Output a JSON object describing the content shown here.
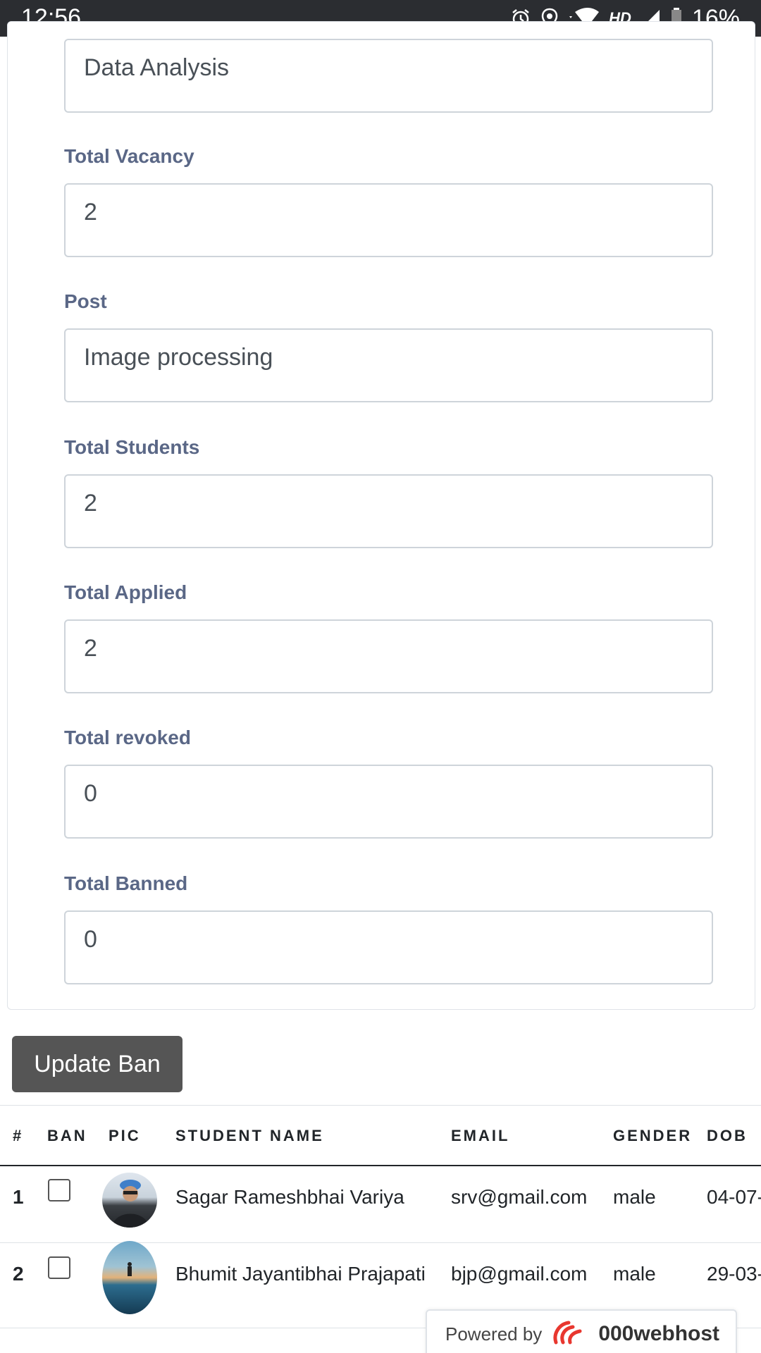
{
  "status_bar": {
    "time": "12:56",
    "network": "HD",
    "battery": "16%"
  },
  "form": {
    "fields": [
      {
        "label": "",
        "value": "Data Analysis"
      },
      {
        "label": "Total Vacancy",
        "value": "2"
      },
      {
        "label": "Post",
        "value": "Image processing"
      },
      {
        "label": "Total Students",
        "value": "2"
      },
      {
        "label": "Total Applied",
        "value": "2"
      },
      {
        "label": "Total revoked",
        "value": "0"
      },
      {
        "label": "Total Banned",
        "value": "0"
      }
    ]
  },
  "update_button": {
    "label": "Update Ban"
  },
  "table": {
    "headers": [
      "#",
      "BAN",
      "PIC",
      "STUDENT NAME",
      "EMAIL",
      "GENDER",
      "DOB"
    ],
    "rows": [
      {
        "num": "1",
        "banned": false,
        "name": "Sagar Rameshbhai Variya",
        "email": "srv@gmail.com",
        "gender": "male",
        "dob": "04-07-"
      },
      {
        "num": "2",
        "banned": false,
        "name": "Bhumit Jayantibhai Prajapati",
        "email": "bjp@gmail.com",
        "gender": "male",
        "dob": "29-03-"
      }
    ]
  },
  "footer_badge": {
    "prefix": "Powered by",
    "brand": "000webhost"
  }
}
